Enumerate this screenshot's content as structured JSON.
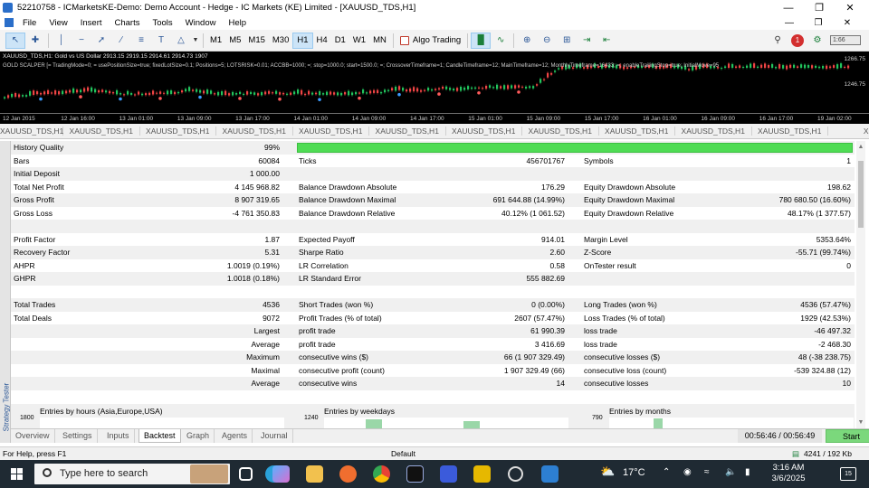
{
  "window": {
    "title": "52210758 - ICMarketsKE-Demo: Demo Account - Hedge - IC Markets (KE) Limited - [XAUUSD_TDS,H1]",
    "controls": [
      "minimize",
      "maximize",
      "close"
    ]
  },
  "menu": {
    "items": [
      "File",
      "View",
      "Insert",
      "Charts",
      "Tools",
      "Window",
      "Help"
    ]
  },
  "toolbar": {
    "tools": [
      "cursor-icon",
      "crosshair-icon",
      "vertical-line-icon",
      "horizontal-line-icon",
      "trendline-icon",
      "channel-icon",
      "fibonacci-icon",
      "text-icon",
      "shapes-icon"
    ],
    "timeframes": [
      "M1",
      "M5",
      "M15",
      "M30",
      "H1",
      "H4",
      "D1",
      "W1",
      "MN"
    ],
    "active_timeframe": "H1",
    "algo_trading": "Algo Trading",
    "notification_count": "1",
    "signal_label": "1:66"
  },
  "chart": {
    "symbol_line": "XAUUSD_TDS,H1: Gold vs US Dollar  2913.15 2919.15 2914.61 2914.73  1907",
    "ea_line": "GOLD SCALPER [= TradingMode=0; = usePositionSize=true; fixedLotSize=0.1; Positions=5; LOTSRISK=0.01; ACCBB=1000; =; stop=1000.0; start=1500.0; =; CrossoverTimeframe=1; CandleTimeframe=12; MainTimeframe=12; MonthlyTimeframe=16433; =; enableTrailingStop=true; InitialMove=95",
    "price_labels": [
      "1266.75",
      "1246.75"
    ],
    "time_labels": [
      "12 Jan 2015",
      "12 Jan 16:00",
      "13 Jan 01:00",
      "13 Jan 09:00",
      "13 Jan 17:00",
      "14 Jan 01:00",
      "14 Jan 09:00",
      "14 Jan 17:00",
      "15 Jan 01:00",
      "15 Jan 09:00",
      "15 Jan 17:00",
      "16 Jan 01:00",
      "16 Jan 09:00",
      "16 Jan 17:00",
      "19 Jan 02:00"
    ],
    "colors": {
      "background": "#000000",
      "bull": "#22c55e",
      "bear": "#ef4444",
      "marker_buy": "#3b9cff",
      "marker_sell": "#ff5b5b"
    }
  },
  "chart_tabs": [
    "XAUUSD_TDS,H1",
    "XAUUSD_TDS,H1",
    "XAUUSD_TDS,H1",
    "XAUUSD_TDS,H1",
    "XAUUSD_TDS,H1",
    "XAUUSD_TDS,H1",
    "XAUUSD_TDS,H1",
    "XAUUSD_TDS,H1",
    "XAUUSD_TDS,H1",
    "XAUUSD_TDS,H1",
    "XAUUSD_TDS,H1",
    "X"
  ],
  "report": {
    "history_quality": {
      "label": "History Quality",
      "value": "99%",
      "fraction": 0.99
    },
    "rows": [
      {
        "c1": [
          "Bars",
          "60084"
        ],
        "c2": [
          "Ticks",
          "456701767"
        ],
        "c3": [
          "Symbols",
          "1"
        ]
      },
      {
        "c1": [
          "Initial Deposit",
          "1 000.00"
        ],
        "c2": [
          "",
          ""
        ],
        "c3": [
          "",
          ""
        ]
      },
      {
        "c1": [
          "Total Net Profit",
          "4 145 968.82"
        ],
        "c2": [
          "Balance Drawdown Absolute",
          "176.29"
        ],
        "c3": [
          "Equity Drawdown Absolute",
          "198.62"
        ]
      },
      {
        "c1": [
          "Gross Profit",
          "8 907 319.65"
        ],
        "c2": [
          "Balance Drawdown Maximal",
          "691 644.88 (14.99%)"
        ],
        "c3": [
          "Equity Drawdown Maximal",
          "780 680.50 (16.60%)"
        ]
      },
      {
        "c1": [
          "Gross Loss",
          "-4 761 350.83"
        ],
        "c2": [
          "Balance Drawdown Relative",
          "40.12% (1 061.52)"
        ],
        "c3": [
          "Equity Drawdown Relative",
          "48.17% (1 377.57)"
        ]
      },
      {
        "c1": [
          "",
          ""
        ],
        "c2": [
          "",
          ""
        ],
        "c3": [
          "",
          ""
        ]
      },
      {
        "c1": [
          "Profit Factor",
          "1.87"
        ],
        "c2": [
          "Expected Payoff",
          "914.01"
        ],
        "c3": [
          "Margin Level",
          "5353.64%"
        ]
      },
      {
        "c1": [
          "Recovery Factor",
          "5.31"
        ],
        "c2": [
          "Sharpe Ratio",
          "2.60"
        ],
        "c3": [
          "Z-Score",
          "-55.71 (99.74%)"
        ]
      },
      {
        "c1": [
          "AHPR",
          "1.0019 (0.19%)"
        ],
        "c2": [
          "LR Correlation",
          "0.58"
        ],
        "c3": [
          "OnTester result",
          "0"
        ]
      },
      {
        "c1": [
          "GHPR",
          "1.0018 (0.18%)"
        ],
        "c2": [
          "LR Standard Error",
          "555 882.69"
        ],
        "c3": [
          "",
          ""
        ]
      },
      {
        "c1": [
          "",
          ""
        ],
        "c2": [
          "",
          ""
        ],
        "c3": [
          "",
          ""
        ]
      },
      {
        "c1": [
          "Total Trades",
          "4536"
        ],
        "c2": [
          "Short Trades (won %)",
          "0 (0.00%)"
        ],
        "c3": [
          "Long Trades (won %)",
          "4536 (57.47%)"
        ]
      },
      {
        "c1": [
          "Total Deals",
          "9072"
        ],
        "c2": [
          "Profit Trades (% of total)",
          "2607 (57.47%)"
        ],
        "c3": [
          "Loss Trades (% of total)",
          "1929 (42.53%)"
        ]
      },
      {
        "c1": [
          "",
          "Largest"
        ],
        "c2": [
          "profit trade",
          "61 990.39"
        ],
        "c3": [
          "loss trade",
          "-46 497.32"
        ]
      },
      {
        "c1": [
          "",
          "Average"
        ],
        "c2": [
          "profit trade",
          "3 416.69"
        ],
        "c3": [
          "loss trade",
          "-2 468.30"
        ]
      },
      {
        "c1": [
          "",
          "Maximum"
        ],
        "c2": [
          "consecutive wins ($)",
          "66 (1 907 329.49)"
        ],
        "c3": [
          "consecutive losses ($)",
          "48 (-38 238.75)"
        ]
      },
      {
        "c1": [
          "",
          "Maximal"
        ],
        "c2": [
          "consecutive profit (count)",
          "1 907 329.49 (66)"
        ],
        "c3": [
          "consecutive loss (count)",
          "-539 324.88 (12)"
        ]
      },
      {
        "c1": [
          "",
          "Average"
        ],
        "c2": [
          "consecutive wins",
          "14"
        ],
        "c3": [
          "consecutive losses",
          "10"
        ]
      }
    ]
  },
  "histograms": [
    {
      "title": "Entries by hours (Asia,Europe,USA)",
      "ymax": "1800"
    },
    {
      "title": "Entries by weekdays",
      "ymax": "1240"
    },
    {
      "title": "Entries by months",
      "ymax": "790"
    }
  ],
  "side_label": "Strategy Tester",
  "bottom_tabs": [
    "Overview",
    "Settings",
    "Inputs",
    "Backtest",
    "Graph",
    "Agents",
    "Journal"
  ],
  "active_bottom_tab": "Backtest",
  "timer": "00:56:46 / 00:56:49",
  "start_label": "Start",
  "status": {
    "help": "For Help, press F1",
    "profile": "Default",
    "traffic": "4241 / 192 Kb"
  },
  "taskbar": {
    "search_placeholder": "Type here to search",
    "apps": [
      "task-view-icon",
      "edge-icon",
      "copilot-icon",
      "file-explorer-icon",
      "firefox-icon",
      "chrome-icon",
      "icmarkets-icon",
      "cpu-icon",
      "sticky-notes-icon",
      "clock-icon",
      "photos-icon"
    ],
    "weather": "17°C",
    "time": "3:16 AM",
    "date": "3/6/2025",
    "notifications": "15"
  }
}
